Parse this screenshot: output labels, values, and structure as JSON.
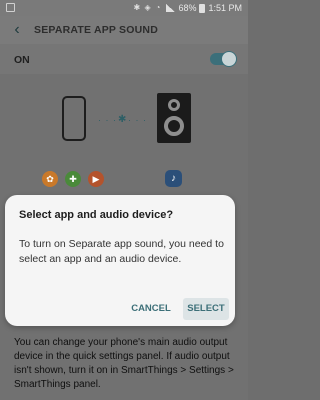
{
  "status_bar": {
    "battery_percent": "68%",
    "time": "1:51 PM"
  },
  "app_bar": {
    "back_glyph": "‹",
    "title": "SEPARATE APP SOUND"
  },
  "toggle_row": {
    "label": "ON",
    "state": "on"
  },
  "illustration": {
    "dots_left": "· · ·",
    "bluetooth_glyph": "✱",
    "dots_right": "· · ·",
    "app_icons": [
      {
        "name": "colorful-app-icon",
        "glyph": "✿",
        "color": "#c9792a"
      },
      {
        "name": "game-app-icon",
        "glyph": "✚",
        "color": "#4a8a3a"
      },
      {
        "name": "video-app-icon",
        "glyph": "▶",
        "color": "#b4532c"
      }
    ],
    "music_glyph": "♪"
  },
  "background_text": {
    "line_a": "P",
    "line_b": "c",
    "line_c": "a",
    "line_d": "S",
    "line_e": "a"
  },
  "dialog": {
    "title": "Select app and audio device?",
    "body": "To turn on Separate app sound, you need to select an app and an audio device.",
    "cancel_label": "CANCEL",
    "select_label": "SELECT"
  },
  "below_text": "You can change your phone's main audio output device in the quick settings panel. If audio output isn't shown, turn it on in SmartThings > Settings > SmartThings panel.",
  "colors": {
    "accent": "#3b6f7a",
    "scrim": "#717171",
    "dialog_bg": "#f5f5f5"
  }
}
